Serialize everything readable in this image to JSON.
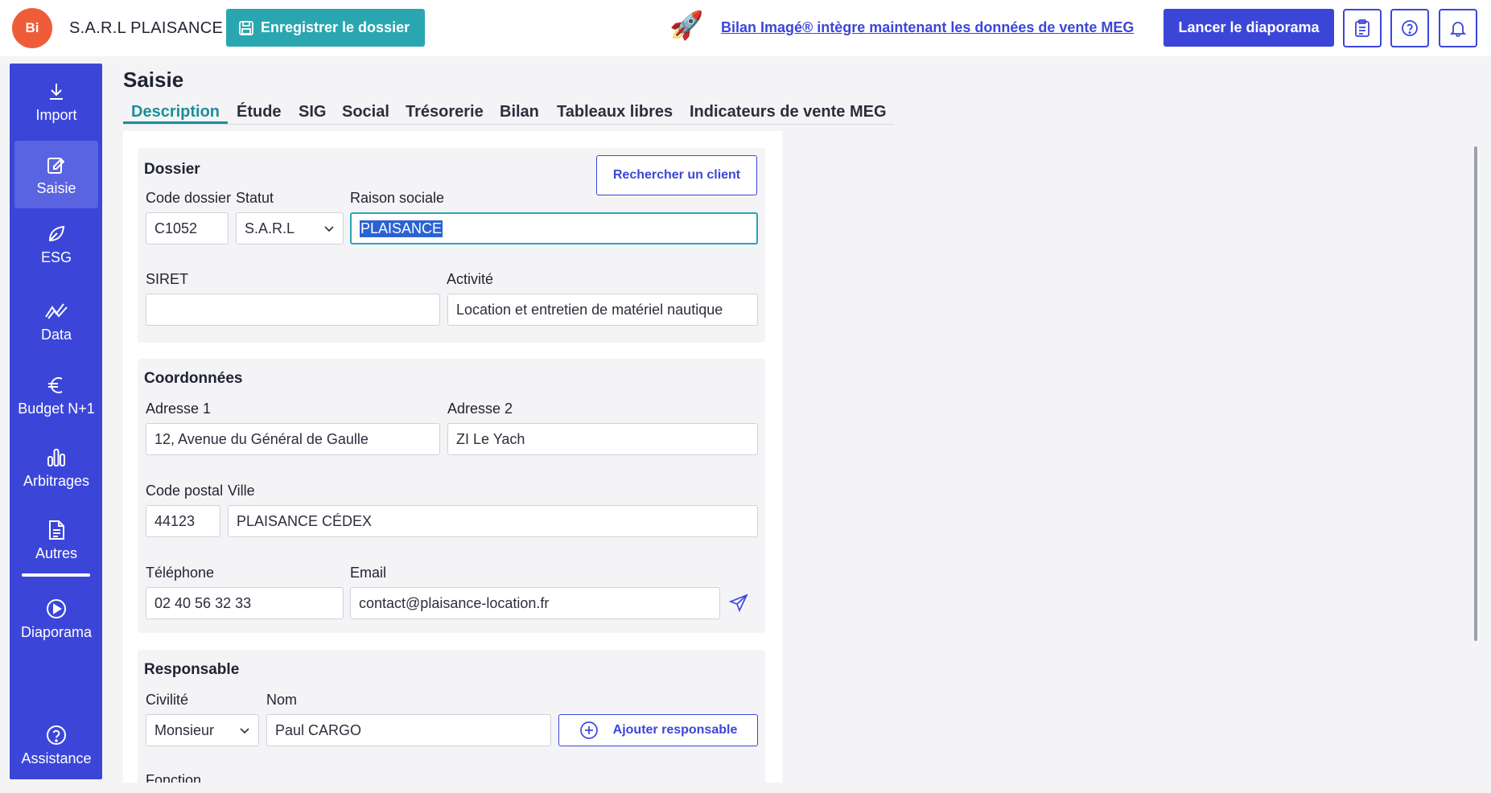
{
  "header": {
    "logo_text": "Bi",
    "company": "S.A.R.L PLAISANCE",
    "save_label": "Enregistrer le dossier",
    "news_text": "Bilan Imagé® intègre maintenant les données de vente MEG",
    "launch_label": "Lancer le diaporama"
  },
  "sidebar": {
    "items": [
      {
        "label": "Import"
      },
      {
        "label": "Saisie"
      },
      {
        "label": "ESG"
      },
      {
        "label": "Data"
      },
      {
        "label": "Budget N+1"
      },
      {
        "label": "Arbitrages"
      },
      {
        "label": "Autres"
      },
      {
        "label": "Diaporama"
      },
      {
        "label": "Assistance"
      }
    ]
  },
  "main": {
    "title": "Saisie",
    "tabs": [
      {
        "label": "Description"
      },
      {
        "label": "Étude"
      },
      {
        "label": "SIG"
      },
      {
        "label": "Social"
      },
      {
        "label": "Trésorerie"
      },
      {
        "label": "Bilan"
      },
      {
        "label": "Tableaux libres"
      },
      {
        "label": "Indicateurs de vente MEG"
      }
    ]
  },
  "dossier": {
    "title": "Dossier",
    "search_button": "Rechercher un client",
    "code_label": "Code dossier",
    "code_value": "C1052",
    "statut_label": "Statut",
    "statut_value": "S.A.R.L",
    "raison_label": "Raison sociale",
    "raison_value": "PLAISANCE",
    "siret_label": "SIRET",
    "siret_value": "",
    "activite_label": "Activité",
    "activite_value": "Location et entretien de matériel nautique"
  },
  "coordonnees": {
    "title": "Coordonnées",
    "adresse1_label": "Adresse 1",
    "adresse1_value": "12, Avenue du Général de Gaulle",
    "adresse2_label": "Adresse 2",
    "adresse2_value": "ZI Le Yach",
    "cp_label": "Code postal",
    "cp_value": "44123",
    "ville_label": "Ville",
    "ville_value": "PLAISANCE CÉDEX",
    "tel_label": "Téléphone",
    "tel_value": "02 40 56 32 33",
    "email_label": "Email",
    "email_value": "contact@plaisance-location.fr"
  },
  "responsable": {
    "title": "Responsable",
    "civilite_label": "Civilité",
    "civilite_value": "Monsieur",
    "nom_label": "Nom",
    "nom_value": "Paul CARGO",
    "add_button": "Ajouter responsable",
    "fonction_label": "Fonction"
  }
}
